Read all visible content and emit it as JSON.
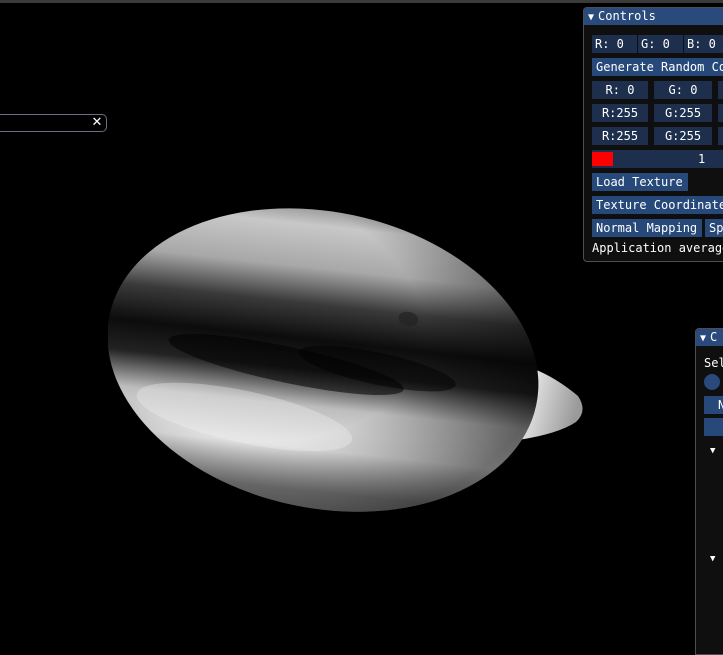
{
  "controls": {
    "title": "Controls",
    "row1": [
      "R:   0",
      "G:   0",
      "B:   0"
    ],
    "generate_label": "Generate Random Co",
    "row2": [
      "R:  0",
      "G:  0"
    ],
    "row3": [
      "R:255",
      "G:255"
    ],
    "row4": [
      "R:255",
      "G:255"
    ],
    "slider_value": "1",
    "load_texture_label": "Load Texture",
    "texture_coordinates_label": "Texture Coordinates",
    "normal_mapping_label": "Normal Mapping",
    "sp_label": "Sp",
    "status_text": "Application average"
  },
  "panel2": {
    "title": "C",
    "select_label": "Sel",
    "button_label": "N"
  },
  "colors": {
    "background": "#000000",
    "title_bar": "#294a7a",
    "field": "#1d2f4c",
    "button": "#26497a",
    "swatch": "#ff0000"
  }
}
